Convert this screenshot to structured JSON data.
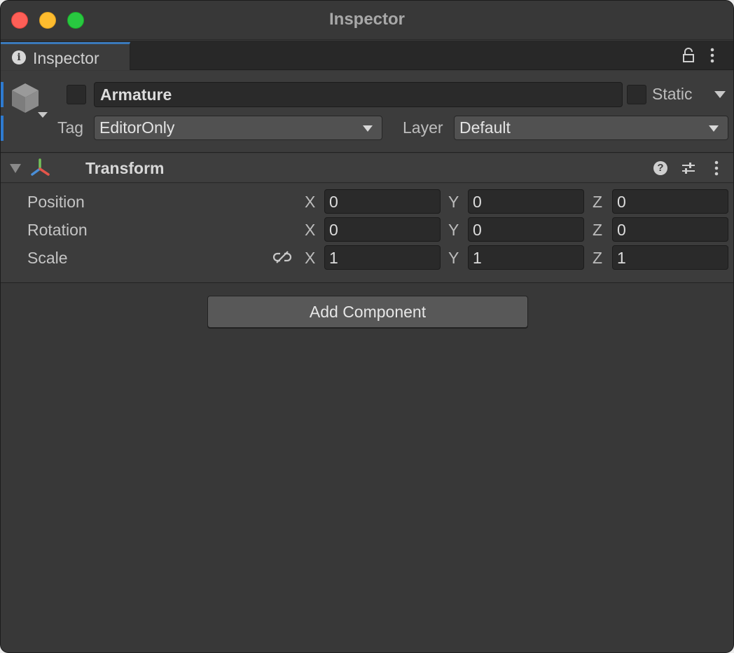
{
  "window": {
    "title": "Inspector"
  },
  "tab": {
    "label": "Inspector",
    "icon": "info-icon"
  },
  "header": {
    "active": false,
    "name": "Armature",
    "static_checked": false,
    "static_label": "Static",
    "tag_label": "Tag",
    "tag_value": "EditorOnly",
    "layer_label": "Layer",
    "layer_value": "Default"
  },
  "component": {
    "title": "Transform",
    "rows": [
      {
        "label": "Position",
        "x": "0",
        "y": "0",
        "z": "0"
      },
      {
        "label": "Rotation",
        "x": "0",
        "y": "0",
        "z": "0"
      },
      {
        "label": "Scale",
        "x": "1",
        "y": "1",
        "z": "1"
      }
    ],
    "axes": {
      "x": "X",
      "y": "Y",
      "z": "Z"
    }
  },
  "add_component_label": "Add Component",
  "colors": {
    "accent": "#2e7bd1",
    "close": "#fe5f57",
    "minimize": "#febc2e",
    "maximize": "#28c840"
  }
}
